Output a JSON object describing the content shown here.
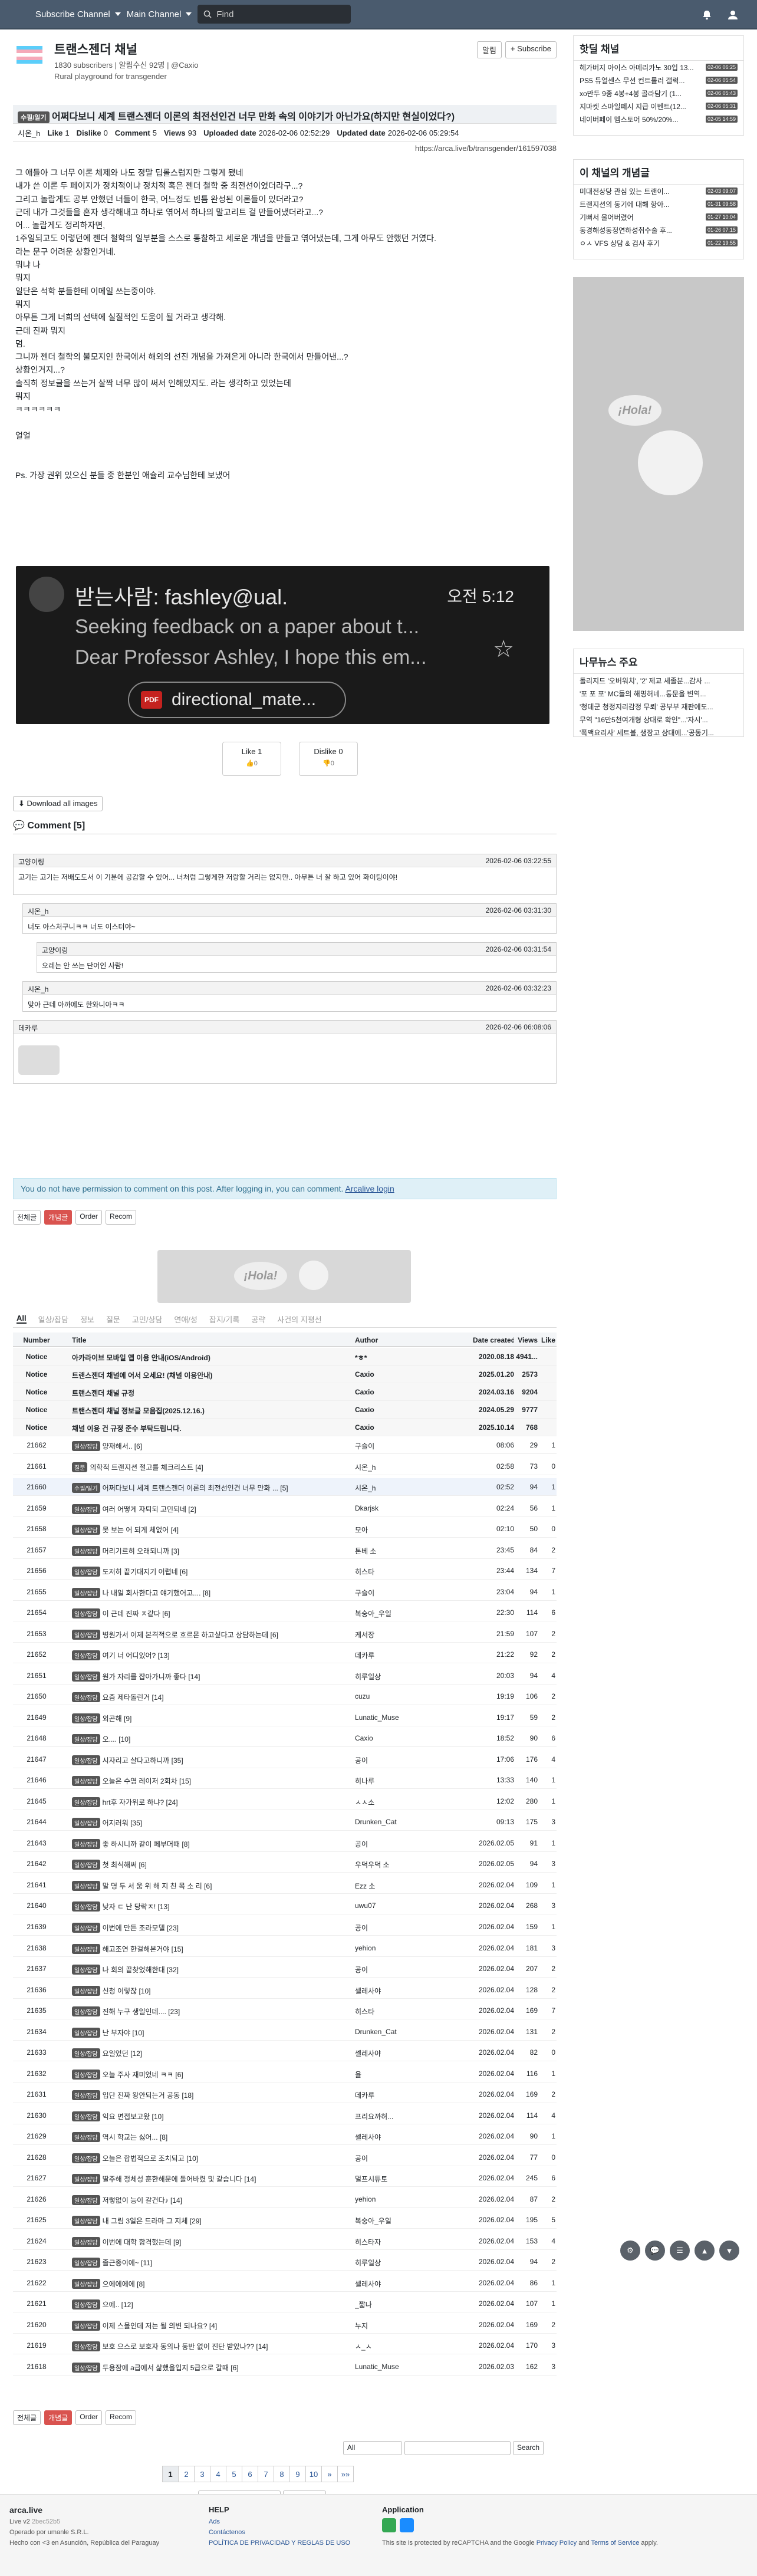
{
  "nav": {
    "subscribe": "Subscribe Channel",
    "main": "Main Channel",
    "search_placeholder": "Find"
  },
  "channel": {
    "title": "트랜스젠더 채널",
    "subscribers": "1830 subscribers",
    "alert": "알림수신 92명",
    "owner": "@Caxio",
    "subtitle": "Rural playground for transgender",
    "alert_btn": "알림",
    "subscribe_btn": "+ Subscribe"
  },
  "post": {
    "category": "수필/일기",
    "title": "어쩌다보니 세계 트랜스젠더 이론의 최전선인건 너무 만화 속의 이야기가 아닌가요(하지만 현실이었다?)",
    "author": "시온_h",
    "like_label": "Like",
    "likes": "1",
    "dislike_label": "Dislike",
    "dislikes": "0",
    "comment_label": "Comment",
    "comments": "5",
    "views_label": "Views",
    "views": "93",
    "uploaded_label": "Uploaded date",
    "uploaded": "2026-02-06 02:52:29",
    "updated_label": "Updated date",
    "updated": "2026-02-06 05:29:54",
    "url": "https://arca.live/b/transgender/161597038",
    "lines": [
      "그 애들아 그 너무 이론 체제와 나도 정말 딥롤스럽지만 그렇게 됐네",
      "내가 쓴 이론 두 페이지가 정치적이냐 정치적 혹은 젠더 철학 중 최전선이었더라구...?",
      "그리고 놀랍게도 공부 안했던 너들이 한국, 어느정도 빈틈 완성된 이론들이 있더라고?",
      "근데 내가 그것들을 혼자 생각해내고 하나로 엮어서 하나의 말고리트 걸 만들어냈더라고...?",
      "어... 놀랍게도 정리하자면,",
      "1주일되고도 이렇던에 젠더 철학의 일부분을 스스로 통찰하고 세로운 개념을 만들고 엮어냈는데, 그게 아무도 안했던 거였다.",
      "라는 문구 어려운 상황인거네.",
      "뭐냐 나",
      "뭐지",
      "일단은 석학 분들한테 이메일 쓰는중이야.",
      "뭐지",
      "아무튼 그게 너희의 선택에 실질적인 도움이 될 거라고 생각해.",
      "근데 진짜 뭐지",
      "멈.",
      "그니까 젠더 철학의 불모지인 한국에서 해외의 선진 개념을 가져온게 아니라 한국에서 만들어낸...?",
      "상황인거지...?",
      "솔직히 정보글을 쓰는거 살짝 너무 많이 써서 인해있지도. 라는 생각하고 있었는데",
      "뭐지",
      "ㅋㅋㅋㅋㅋㅋ",
      "",
      "얼얼",
      "",
      "",
      "Ps. 가장 권위 있으신 분들 중 한분인 애슐리 교수님한테 보냈어"
    ],
    "email": {
      "to": "받는사람: fashley@ual.",
      "time": "오전 5:12",
      "subject": "Seeking feedback on a paper about t...",
      "preview": "Dear Professor Ashley, I hope this em...",
      "attachment": "directional_mate...",
      "pdf": "PDF"
    },
    "download": "Download all images"
  },
  "comments": {
    "header": "Comment [5]",
    "items": [
      {
        "author": "고양이링",
        "date": "2026-02-06 03:22:55",
        "text": "고기는 고기는 저배도도서 이 기분에 공감할 수 있어... 너처럼 그렇게한 저랑할 거리는 없지만.. 아무튼 너 잘 하고 있어 화이팅이야!"
      },
      {
        "author": "시온_h",
        "date": "2026-02-06 03:31:30",
        "text": "너도 아스처구니ㅋㅋ 너도 이스터야~"
      },
      {
        "author": "고양이링",
        "date": "2026-02-06 03:31:54",
        "text": "오레는 안 쓰는 단어인 사람!"
      },
      {
        "author": "시온_h",
        "date": "2026-02-06 03:32:23",
        "text": "맞아 근데 아까에도 한와니아ㅋㅋ"
      },
      {
        "author": "데카루",
        "date": "2026-02-06 06:08:06",
        "text": ""
      }
    ]
  },
  "login_notice": {
    "text": "You do not have permission to comment on this post. After logging in, you can comment.",
    "link": "Arcalive login"
  },
  "tools": {
    "all": "전체글",
    "recommend": "개념글",
    "order": "Order",
    "recom": "Recom"
  },
  "tabs": [
    "All",
    "일상/잡담",
    "정보",
    "질문",
    "고민/상담",
    "연애/성",
    "잡지/기록",
    "공략",
    "사건의 지평선"
  ],
  "table": {
    "headers": [
      "Number",
      "Title",
      "Author",
      "Date created",
      "Views",
      "Like"
    ],
    "notices": [
      {
        "num": "Notice",
        "title": "아카라이브 모바일 앱 이용 안내(iOS/Android)",
        "author": "*ㅎ*",
        "date": "2020.08.18",
        "views": "4941...",
        "likes": ""
      },
      {
        "num": "Notice",
        "title": "트랜스젠더 채널에 어서 오세요! (채널 이용안내)",
        "author": "Caxio",
        "date": "2025.01.20",
        "views": "2573",
        "likes": ""
      },
      {
        "num": "Notice",
        "title": "트랜스젠더 채널 규정",
        "author": "Caxio",
        "date": "2024.03.16",
        "views": "9204",
        "likes": ""
      },
      {
        "num": "Notice",
        "title": "트랜스젠더 채널 정보글 모음집(2025.12.16.)",
        "author": "Caxio",
        "date": "2024.05.29",
        "views": "9777",
        "likes": ""
      },
      {
        "num": "Notice",
        "title": "채널 이용 건 규정 준수 부탁드립니다.",
        "author": "Caxio",
        "date": "2025.10.14",
        "views": "768",
        "likes": ""
      }
    ],
    "rows": [
      [
        "21662",
        "일상/잡담",
        "양재해서.. [6]",
        "구슬이",
        "08:06",
        "29",
        "1"
      ],
      [
        "21661",
        "질문",
        "의학적 트랜지션 절고를 체크리스트 [4]",
        "시온_h",
        "02:58",
        "73",
        "0"
      ],
      [
        "21660",
        "수필/일기",
        "어쩌다보니 세계 트랜스젠더 이론의 최전선인건 너무 만화 ... [5]",
        "시온_h",
        "02:52",
        "94",
        "1"
      ],
      [
        "21659",
        "일상/잡담",
        "여러 어떻게 자퇴되 고민되네 [2]",
        "Dkarjsk",
        "02:24",
        "56",
        "1"
      ],
      [
        "21658",
        "일상/잡담",
        "못 보는 어 되게 체없어 [4]",
        "모아",
        "02:10",
        "50",
        "0"
      ],
      [
        "21657",
        "일상/잡담",
        "머리기르히 오래되니까 [3]",
        "톤베 소",
        "23:45",
        "84",
        "2"
      ],
      [
        "21656",
        "일상/잡담",
        "도저히 끝기대지기 어렵네 [6]",
        "히스타",
        "23:44",
        "134",
        "7"
      ],
      [
        "21655",
        "일상/잡담",
        "나 내일 회사한다고 얘기했어고.... [8]",
        "구슬이",
        "23:04",
        "94",
        "1"
      ],
      [
        "21654",
        "일상/잡담",
        "이 근데 진짜 ㅈ같다 [6]",
        "복숭아_우일",
        "22:30",
        "114",
        "6"
      ],
      [
        "21653",
        "일상/잡담",
        "병원가서 이제 본격적으로 호르몬 하고싶다고 상담하는데 [6]",
        "케서장",
        "21:59",
        "107",
        "2"
      ],
      [
        "21652",
        "일상/잡담",
        "여기 너 어디있어? [13]",
        "데카루",
        "21:22",
        "92",
        "2"
      ],
      [
        "21651",
        "일상/잡담",
        "원가 자리를 잡아가니까 좋다 [14]",
        "히루일상",
        "20:03",
        "94",
        "4"
      ],
      [
        "21650",
        "일상/잡담",
        "요즘 제타돌린거 [14]",
        "cuzu",
        "19:19",
        "106",
        "2"
      ],
      [
        "21649",
        "일상/잡담",
        "외곤해 [9]",
        "Lunatic_Muse",
        "19:17",
        "59",
        "2"
      ],
      [
        "21648",
        "일상/잡담",
        "오.... [10]",
        "Caxio",
        "18:52",
        "90",
        "6"
      ],
      [
        "21647",
        "일상/잡담",
        "시자리고 살다고하니까 [35]",
        "공이",
        "17:06",
        "176",
        "4"
      ],
      [
        "21646",
        "일상/잡담",
        "오늘은 수염 레이저 2회차 [15]",
        "히나루",
        "13:33",
        "140",
        "1"
      ],
      [
        "21645",
        "일상/잡담",
        "hrt후 자가위로 하냐? [24]",
        "ㅅㅅ소",
        "12:02",
        "280",
        "1"
      ],
      [
        "21644",
        "일상/잡담",
        "어지러워 [35]",
        "Drunken_Cat",
        "09:13",
        "175",
        "3"
      ],
      [
        "21643",
        "일상/잡담",
        "좋 하시니까 같이 페부머때 [8]",
        "공이",
        "2026.02.05",
        "91",
        "1"
      ],
      [
        "21642",
        "일상/잡담",
        "첫 최식해써 [6]",
        "우덕우덕 소",
        "2026.02.05",
        "94",
        "3"
      ],
      [
        "21641",
        "일상/잡담",
        "말 명 두 서 움 위 해 지 친 목 소 리 [6]",
        "Ezz 소",
        "2026.02.04",
        "109",
        "1"
      ],
      [
        "21640",
        "일상/잡담",
        "낮자 ㄷ 난 당락ㅈ! [13]",
        "uwu07",
        "2026.02.04",
        "268",
        "3"
      ],
      [
        "21639",
        "일상/잡담",
        "이번에 만든 조라모델 [23]",
        "공이",
        "2026.02.04",
        "159",
        "1"
      ],
      [
        "21638",
        "일상/잡담",
        "해고조연 한걸해본거야 [15]",
        "yehion",
        "2026.02.04",
        "181",
        "3"
      ],
      [
        "21637",
        "일상/잡담",
        "나 회의 끝찾었해한대 [32]",
        "공이",
        "2026.02.04",
        "207",
        "2"
      ],
      [
        "21636",
        "일상/잡담",
        "신청 이렇잖 [10]",
        "셀레사야",
        "2026.02.04",
        "128",
        "2"
      ],
      [
        "21635",
        "일상/잡담",
        "진해 누구 생일인데.... [23]",
        "히스타",
        "2026.02.04",
        "169",
        "7"
      ],
      [
        "21634",
        "일상/잡담",
        "난 부자야 [10]",
        "Drunken_Cat",
        "2026.02.04",
        "131",
        "2"
      ],
      [
        "21633",
        "일상/잡담",
        "요일었던 [12]",
        "셀레사야",
        "2026.02.04",
        "82",
        "0"
      ],
      [
        "21632",
        "일상/잡담",
        "오늘 주사 재미었네 ㅋㅋ [6]",
        "율",
        "2026.02.04",
        "116",
        "1"
      ],
      [
        "21631",
        "일상/잡담",
        "입단 진짜 왕안되는거 공동 [18]",
        "데카루",
        "2026.02.04",
        "169",
        "2"
      ],
      [
        "21630",
        "일상/잡담",
        "익요 면접보고왔 [10]",
        "프리요까허...",
        "2026.02.04",
        "114",
        "4"
      ],
      [
        "21629",
        "일상/잡담",
        "역시 학교는 싫어... [8]",
        "셀레사야",
        "2026.02.04",
        "90",
        "1"
      ],
      [
        "21628",
        "일상/잡담",
        "오늘은 합법적으로 조치되고 [10]",
        "공이",
        "2026.02.04",
        "77",
        "0"
      ],
      [
        "21627",
        "일상/잡담",
        "딸주해 정체성 훈한해문에 돌어바렸 및 같습니다 [14]",
        "멀프시튜토",
        "2026.02.04",
        "245",
        "6"
      ],
      [
        "21626",
        "일상/잡담",
        "저렇없이 능이 갈건다♪ [14]",
        "yehion",
        "2026.02.04",
        "87",
        "2"
      ],
      [
        "21625",
        "일상/잡담",
        "내 그림 3일은 드라마 그 지체 [29]",
        "복숭아_우일",
        "2026.02.04",
        "195",
        "5"
      ],
      [
        "21624",
        "일상/잡담",
        "이번에 대학 합격했는데 [9]",
        "히스타자",
        "2026.02.04",
        "153",
        "4"
      ],
      [
        "21623",
        "일상/잡담",
        "졸근종이에~ [11]",
        "히루일상",
        "2026.02.04",
        "94",
        "2"
      ],
      [
        "21622",
        "일상/잡담",
        "으에에에에 [8]",
        "셀레사야",
        "2026.02.04",
        "86",
        "1"
      ],
      [
        "21621",
        "일상/잡담",
        "으에.. [12]",
        "_짧나",
        "2026.02.04",
        "107",
        "1"
      ],
      [
        "21620",
        "일상/잡담",
        "이제 스몰인데 저는 될 의변 되나요? [4]",
        "누지",
        "2026.02.04",
        "169",
        "2"
      ],
      [
        "21619",
        "일상/잡담",
        "보호 으스로 보호자 동의나 동반 없이 진단 받았나?? [14]",
        "ㅅ_ㅅ",
        "2026.02.04",
        "170",
        "3"
      ],
      [
        "21618",
        "일상/잡담",
        "두용잠에 a급에서 삶했을입지 5급으로 갈때 [6]",
        "Lunatic_Muse",
        "2026.02.03",
        "162",
        "3"
      ]
    ]
  },
  "search": {
    "scope": "All",
    "button": "Search"
  },
  "pagination": [
    "1",
    "2",
    "3",
    "4",
    "5",
    "6",
    "7",
    "8",
    "9",
    "10",
    "»",
    "»»"
  ],
  "date_jump": {
    "placeholder": "mm/dd/yyyy, --:-- --",
    "button": "Go to Time"
  },
  "sidebar": {
    "hot_title": "핫딜 채널",
    "hot": [
      {
        "t": "헤가버지 아이스 아메리카노 30입 13...",
        "ts": "02-06 06:25"
      },
      {
        "t": "PS5 듀얼센스 무선 컨트롤러 갤럭...",
        "ts": "02-06 05:54"
      },
      {
        "t": "xo만두 9종 4봉+4봉 골라담기 (1...",
        "ts": "02-06 05:43"
      },
      {
        "t": "지마켓 스마일페시 지급 이벤트(12...",
        "ts": "02-06 05:31"
      },
      {
        "t": "네이버페이 멤스토어 50%/20%...",
        "ts": "02-05 14:59"
      }
    ],
    "concept_title": "이 채널의 개념글",
    "concept": [
      {
        "t": "미대전상당 관심 있는 트랜이...",
        "ts": "02-03 09:07"
      },
      {
        "t": "트랜지션의 동기에 대해 항아...",
        "ts": "01-31 09:58"
      },
      {
        "t": "기뻐서 울어버렸어",
        "ts": "01-27 10:04"
      },
      {
        "t": "동경해성동정연하성취수술 후...",
        "ts": "01-26 07:15"
      },
      {
        "t": "ㅇㅅ VFS 상담 & 검사 후기",
        "ts": "01-22 19:55"
      }
    ],
    "news_title": "나무뉴스 주요",
    "news": [
      "돌리지드 '오버워치', '2' 제교 세졸분...감사 ...",
      "'포 포 포' MC들의 해명허네...통문을 변역...",
      "'청데군 청정지리감정 무뢰' 공부부 재판에도...",
      "무역 \"16만5천여개형 상대로 확인\"...'자시'...",
      "'폭맥요리사' 세트볼, 생장고 상대에...'공동기..."
    ]
  },
  "footer": {
    "brand": "arca.live",
    "version": "Live v2",
    "ver_hash": "2bec52b5",
    "operator": "Operado por umanle S.R.L.",
    "made": "Hecho con <3 en Asunción, República del Paraguay",
    "help": "HELP",
    "ads": "Ads",
    "contact": "Contáctenos",
    "policy": "POLÍTICA DE PRIVACIDAD Y REGLAS DE USO",
    "app": "Application",
    "recaptcha": "This site is protected by reCAPTCHA and the Google",
    "privacy": "Privacy Policy",
    "and": "and",
    "terms": "Terms of Service",
    "apply": "apply."
  }
}
